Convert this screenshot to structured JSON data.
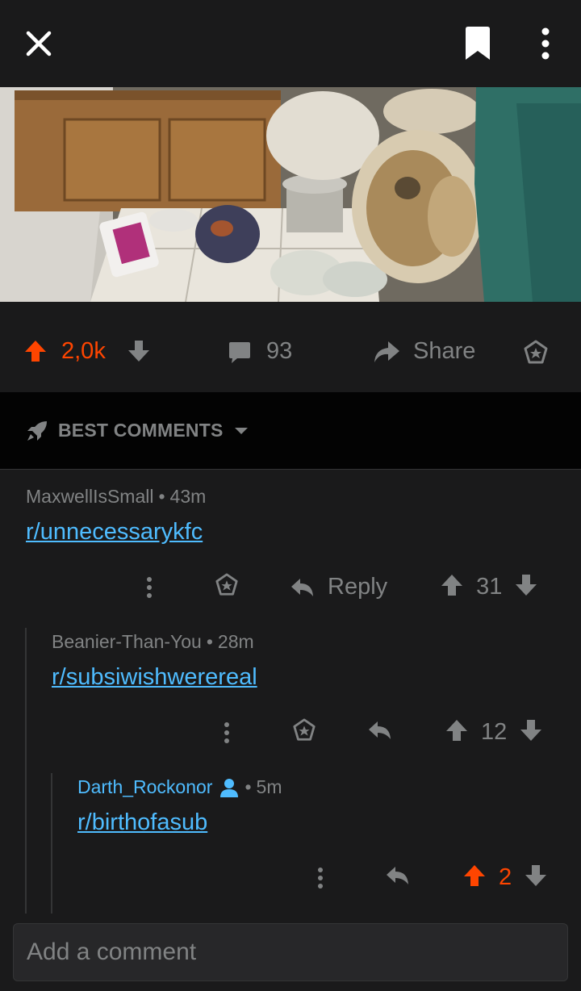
{
  "colors": {
    "background": "#1a1a1b",
    "upvote_active": "#ff4500",
    "link": "#4fbcff",
    "muted": "#818384"
  },
  "topbar": {
    "close_icon": "close-icon",
    "save_icon": "bookmark-icon",
    "more_icon": "more-vertical-icon"
  },
  "post": {
    "image_alt": "Messy bathroom with cluttered toilet",
    "votes": "2,0k",
    "vote_state": "upvoted",
    "comments_count": "93",
    "share_label": "Share"
  },
  "sort": {
    "label": "BEST COMMENTS"
  },
  "comments": [
    {
      "author": "MaxwellIsSmall",
      "age": "43m",
      "text": "r/unnecessarykfc",
      "reply_label": "Reply",
      "score": "31"
    },
    {
      "author": "Beanier-Than-You",
      "age": "28m",
      "text": "r/subsiwishwerereal",
      "score": "12"
    },
    {
      "author": "Darth_Rockonor",
      "age": "5m",
      "text": "r/birthofasub",
      "score": "2",
      "is_op": true
    }
  ],
  "composer": {
    "placeholder": "Add a comment"
  }
}
